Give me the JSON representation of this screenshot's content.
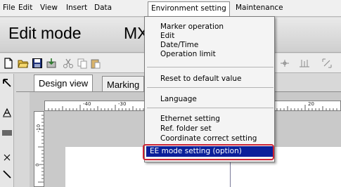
{
  "menubar": {
    "items": [
      "File",
      "Edit",
      "View",
      "Insert",
      "Data",
      "Environment setting",
      "Maintenance"
    ]
  },
  "header": {
    "mode_title": "Edit mode",
    "device_model": "MX"
  },
  "tabs": [
    "Design view",
    "Marking"
  ],
  "ruler": {
    "h_labels": [
      "-40",
      "-30",
      "20"
    ],
    "v_labels": [
      "-10",
      "0"
    ]
  },
  "dropdown": {
    "groups": [
      [
        "Marker operation",
        "Edit",
        "Date/Time",
        "Operation limit"
      ],
      [
        "Reset to default value"
      ],
      [
        "Language"
      ],
      [
        "Ethernet setting",
        "Ref. folder set",
        "Coordinate correct setting",
        "EE mode setting (option)"
      ]
    ],
    "selected": "EE mode setting (option)"
  },
  "colors": {
    "selection": "#0b1f9a",
    "callout": "#cc2233"
  },
  "icons": {
    "toolbar": [
      "new-file-icon",
      "open-folder-icon",
      "save-icon",
      "export-icon",
      "cut-icon",
      "copy-icon",
      "paste-icon",
      "plus-axis-icon",
      "baseline-icon",
      "fit-icon"
    ],
    "tools": [
      "pointer-icon",
      "text-tool-icon",
      "barcode-tool-icon",
      "close-icon",
      "line-tool-icon"
    ]
  }
}
